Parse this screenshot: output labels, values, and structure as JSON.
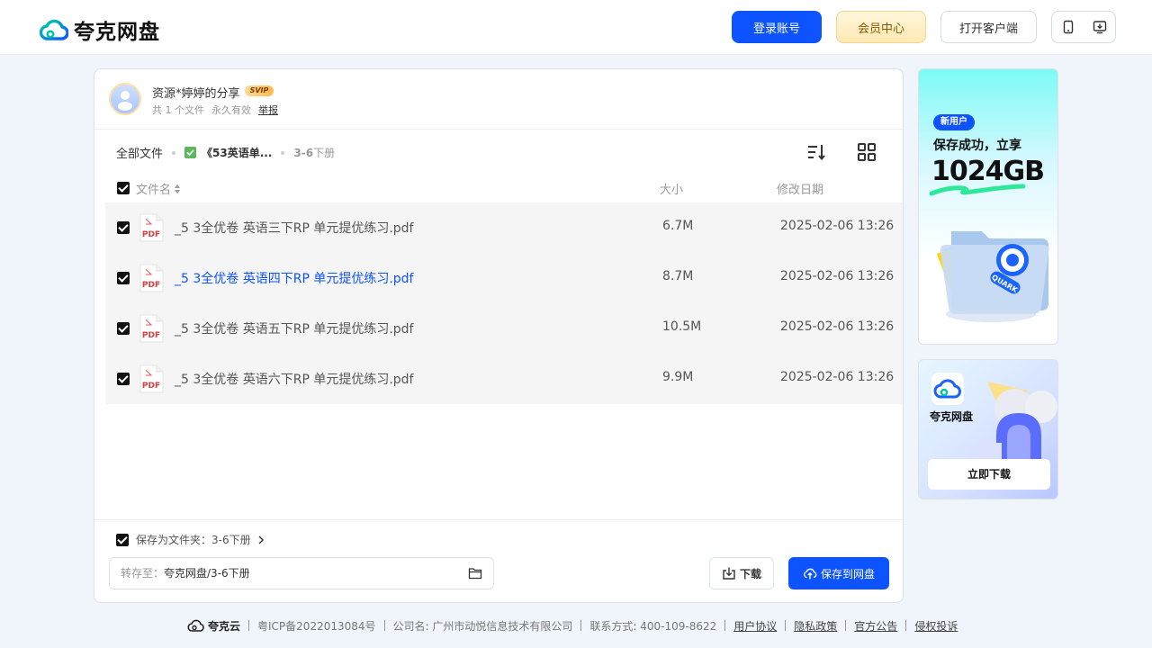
{
  "header": {
    "logo_text": "夸克网盘",
    "login_label": "登录账号",
    "vip_label": "会员中心",
    "client_label": "打开客户端"
  },
  "share": {
    "title": "资源*婷婷的分享",
    "badge": "SVIP",
    "file_count": "共 1 个文件",
    "validity": "永久有效",
    "report": "举报"
  },
  "breadcrumb": {
    "root": "全部文件",
    "folder": "《53英语单...",
    "current_bold": "3-6",
    "current_rest": "下册"
  },
  "columns": {
    "name": "文件名",
    "size": "大小",
    "date": "修改日期"
  },
  "files": [
    {
      "name": "_5 3全优卷 英语三下RP 单元提优练习.pdf",
      "size": "6.7M",
      "date": "2025-02-06 13:26",
      "icon_label": "PDF"
    },
    {
      "name": "_5 3全优卷 英语四下RP 单元提优练习.pdf",
      "size": "8.7M",
      "date": "2025-02-06 13:26",
      "icon_label": "PDF"
    },
    {
      "name": "_5 3全优卷 英语五下RP 单元提优练习.pdf",
      "size": "10.5M",
      "date": "2025-02-06 13:26",
      "icon_label": "PDF"
    },
    {
      "name": "_5 3全优卷 英语六下RP 单元提优练习.pdf",
      "size": "9.9M",
      "date": "2025-02-06 13:26",
      "icon_label": "PDF"
    }
  ],
  "footer_bar": {
    "save_as_folder": "保存为文件夹：3-6下册",
    "dest_label": "转存至：",
    "dest_path": "夸克网盘/3-6下册",
    "download_label": "下载",
    "save_label": "保存到网盘"
  },
  "ads": {
    "ad1_badge": "新用户",
    "ad1_line1": "保存成功，立享",
    "ad1_line2": "1024GB",
    "ad1_folder_text": "QUARK",
    "ad2_name": "夸克网盘",
    "ad2_button": "立即下载"
  },
  "site_footer": {
    "logo": "夸克云",
    "icp": "粤ICP备2022013084号",
    "company": "公司名: 广州市动悦信息技术有限公司",
    "contact": "联系方式: 400-109-8622",
    "user_agreement": "用户协议",
    "privacy": "隐私政策",
    "announcement": "官方公告",
    "complaint": "侵权投诉"
  },
  "colors": {
    "brand_blue": "#0d53ff",
    "row_bg": "#f5f5f5"
  }
}
